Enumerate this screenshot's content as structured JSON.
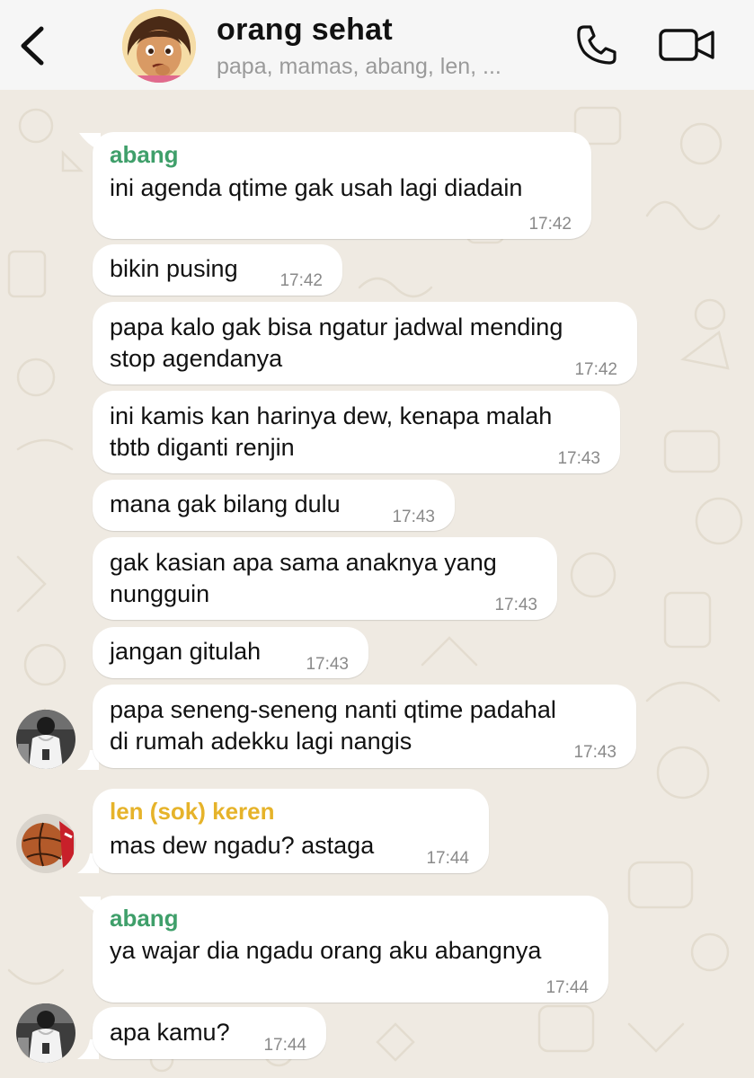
{
  "header": {
    "back_icon": "chevron-left-icon",
    "title": "orang sehat",
    "members": "papa, mamas, abang, len, ...",
    "call_icon": "phone-icon",
    "video_icon": "video-camera-icon"
  },
  "messages": [
    {
      "sender": "abang",
      "lines": [
        "ini agenda qtime gak usah lagi diadain"
      ],
      "time": "17:42"
    },
    {
      "lines": [
        "bikin pusing"
      ],
      "time": "17:42"
    },
    {
      "lines": [
        "papa kalo gak bisa ngatur jadwal mending",
        "stop agendanya"
      ],
      "time": "17:42"
    },
    {
      "lines": [
        "ini kamis kan harinya dew, kenapa malah",
        "tbtb diganti renjin"
      ],
      "time": "17:43"
    },
    {
      "lines": [
        "mana gak bilang dulu"
      ],
      "time": "17:43"
    },
    {
      "lines": [
        "gak kasian apa sama anaknya yang",
        "nungguin"
      ],
      "time": "17:43"
    },
    {
      "lines": [
        "jangan gitulah"
      ],
      "time": "17:43"
    },
    {
      "lines": [
        "papa seneng-seneng nanti qtime padahal",
        "di rumah adekku lagi nangis"
      ],
      "time": "17:43"
    },
    {
      "sender": "len (sok) keren",
      "lines": [
        "mas dew ngadu? astaga"
      ],
      "time": "17:44"
    },
    {
      "sender": "abang",
      "lines": [
        "ya wajar dia ngadu orang aku abangnya"
      ],
      "time": "17:44"
    },
    {
      "lines": [
        "apa kamu?"
      ],
      "time": "17:44"
    }
  ],
  "colors": {
    "sender_abang": "#3f9f6a",
    "sender_len": "#e6b32a",
    "chat_background": "#efeae2"
  }
}
